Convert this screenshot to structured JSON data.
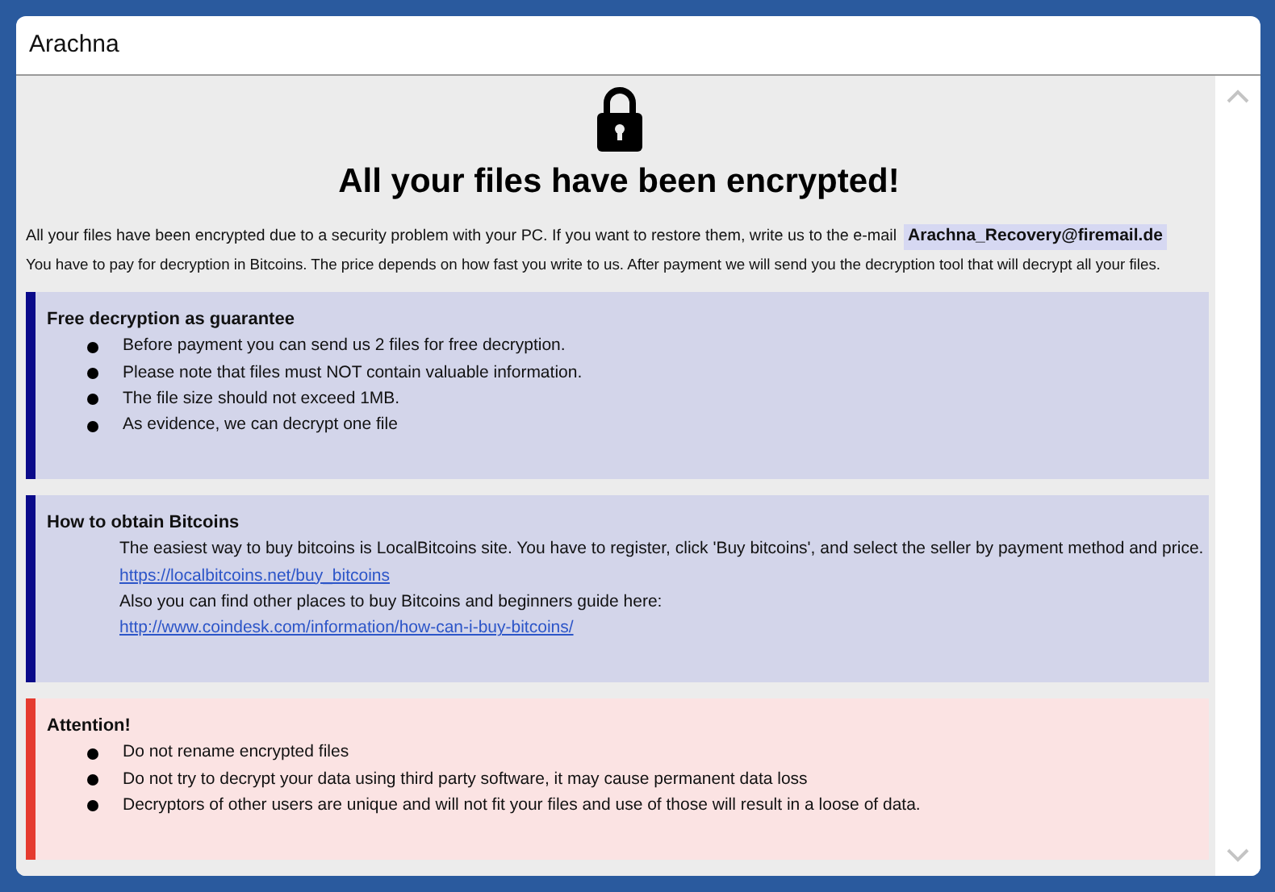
{
  "window": {
    "title": "Arachna"
  },
  "heading": "All your files have been encrypted!",
  "intro": {
    "line_1": "All your files have been encrypted due to a security problem with your PC. If you want to restore them, write us to the e-mail",
    "email": "Arachna_Recovery@firemail.de",
    "line_2": "You have to pay for decryption in Bitcoins. The price depends on how fast you write to us. After payment we will send you the decryption tool that will decrypt all your files."
  },
  "sections": [
    {
      "kind": "info",
      "title": "Free decryption as guarantee",
      "items": [
        {
          "kind": "bullet",
          "text": "Before payment you can send us 2 files for free decryption."
        },
        {
          "kind": "bullet",
          "text": "Please note that files must NOT contain valuable information."
        },
        {
          "kind": "bullet",
          "text": "The file size should not exceed 1MB."
        },
        {
          "kind": "bullet",
          "text": "As evidence, we can decrypt one file"
        }
      ]
    },
    {
      "kind": "info",
      "title": "How to obtain Bitcoins",
      "items": [
        {
          "kind": "text",
          "text": "The easiest way to buy bitcoins is LocalBitcoins site. You have to register, click 'Buy bitcoins', and select the seller by payment method and price."
        },
        {
          "kind": "link",
          "text": "https://localbitcoins.net/buy_bitcoins"
        },
        {
          "kind": "text",
          "text": "Also you can find other places to buy Bitcoins and beginners guide here:"
        },
        {
          "kind": "link",
          "text": "http://www.coindesk.com/information/how-can-i-buy-bitcoins/"
        }
      ]
    },
    {
      "kind": "warning",
      "title": "Attention!",
      "items": [
        {
          "kind": "bullet",
          "text": "Do not rename encrypted files"
        },
        {
          "kind": "bullet",
          "text": "Do not try to decrypt your data using third party software, it may cause permanent data loss"
        },
        {
          "kind": "bullet",
          "text": "Decryptors of other users are unique and will not fit your files and use of those will result in a loose of data."
        }
      ]
    }
  ]
}
